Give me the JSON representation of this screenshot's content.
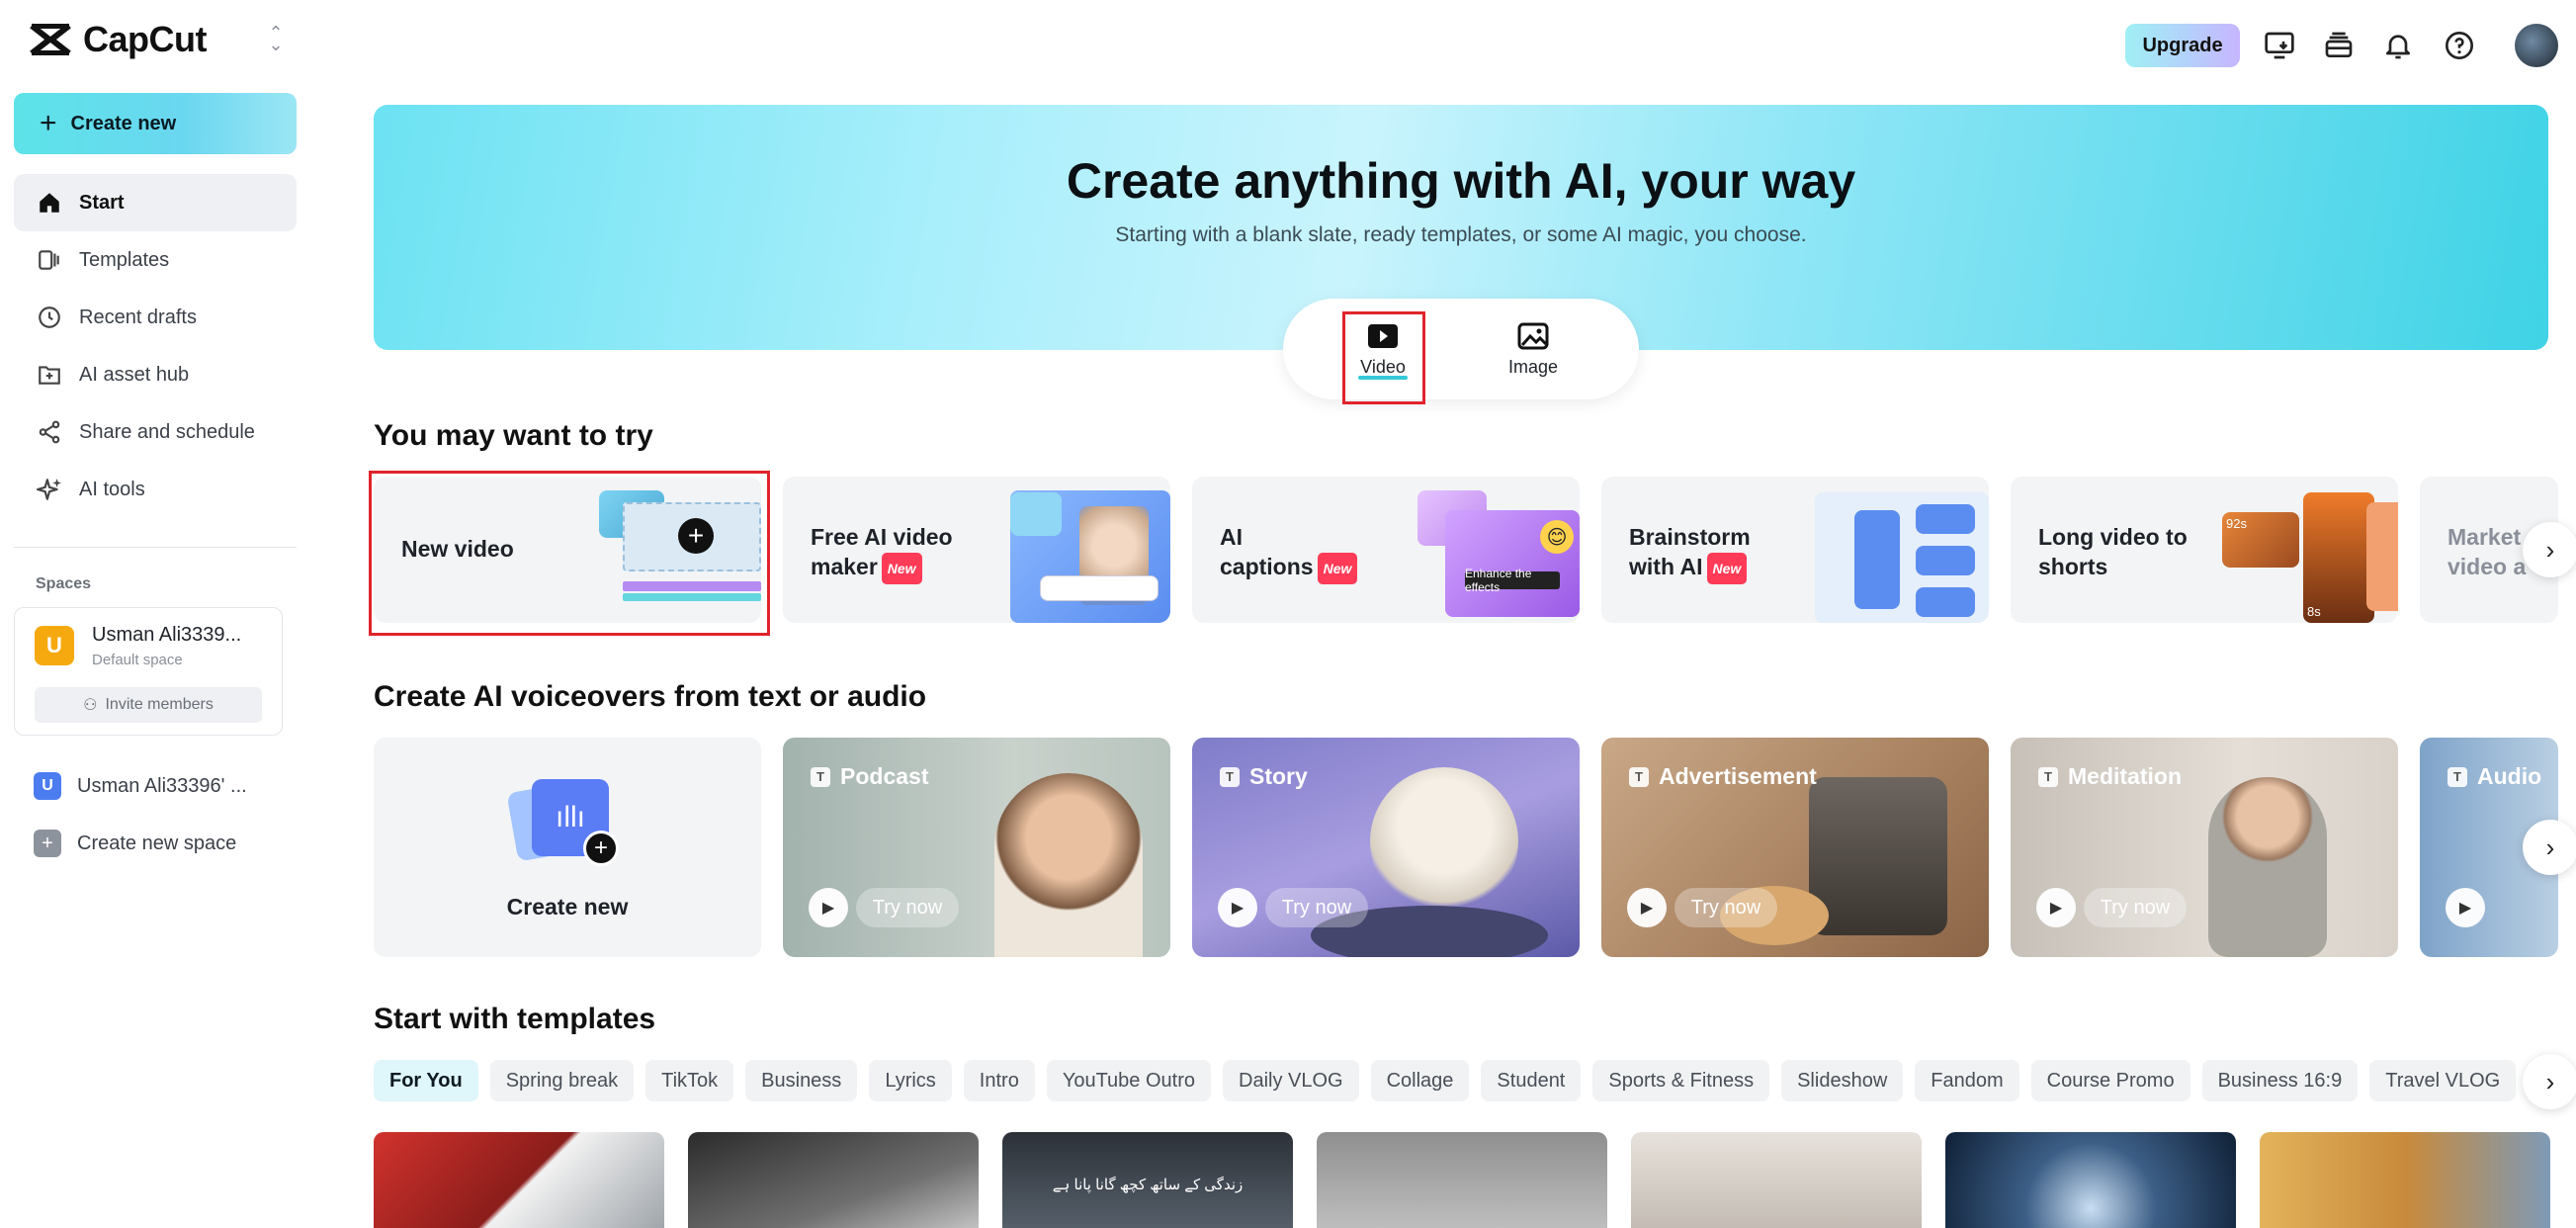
{
  "app": {
    "name": "CapCut"
  },
  "sidebar": {
    "create_label": "Create new",
    "items": [
      {
        "label": "Start",
        "icon": "home-icon"
      },
      {
        "label": "Templates",
        "icon": "templates-icon"
      },
      {
        "label": "Recent drafts",
        "icon": "clock-icon"
      },
      {
        "label": "AI asset hub",
        "icon": "folder-plus-icon"
      },
      {
        "label": "Share and schedule",
        "icon": "share-icon"
      },
      {
        "label": "AI tools",
        "icon": "sparkle-icon"
      }
    ],
    "spaces_title": "Spaces",
    "space": {
      "initial": "U",
      "name": "Usman Ali3339...",
      "sub": "Default space",
      "invite_label": "Invite members"
    },
    "other_space": {
      "initial": "U",
      "name": "Usman Ali33396' ..."
    },
    "create_space_label": "Create new space"
  },
  "topbar": {
    "upgrade_label": "Upgrade"
  },
  "hero": {
    "title": "Create anything with AI, your way",
    "subtitle": "Starting with a blank slate, ready templates, or some AI magic, you choose.",
    "modes": [
      {
        "label": "Video"
      },
      {
        "label": "Image"
      }
    ],
    "selected_mode": "Video"
  },
  "try_section": {
    "title": "You may want to try",
    "cards": [
      {
        "line1": "New video",
        "line2": "",
        "new": false
      },
      {
        "line1": "Free AI video",
        "line2": "maker",
        "new": true
      },
      {
        "line1": "AI",
        "line2": "captions",
        "new": true
      },
      {
        "line1": "Brainstorm",
        "line2": "with AI",
        "new": true
      },
      {
        "line1": "Long video to",
        "line2": "shorts",
        "new": false
      },
      {
        "line1": "Market",
        "line2": "video a",
        "new": false
      }
    ],
    "new_badge": "New",
    "thumb_caption": "Enhance the effects",
    "thumb_times": [
      "92s",
      "8s"
    ]
  },
  "voice_section": {
    "title": "Create AI voiceovers from text or audio",
    "create_label": "Create new",
    "try_label": "Try now",
    "cards": [
      {
        "label": "Podcast"
      },
      {
        "label": "Story"
      },
      {
        "label": "Advertisement"
      },
      {
        "label": "Meditation"
      },
      {
        "label": "Audio"
      }
    ]
  },
  "templates_section": {
    "title": "Start with templates",
    "chips": [
      "For You",
      "Spring break",
      "TikTok",
      "Business",
      "Lyrics",
      "Intro",
      "YouTube Outro",
      "Daily VLOG",
      "Collage",
      "Student",
      "Sports & Fitness",
      "Slideshow",
      "Fandom",
      "Course Promo",
      "Business 16:9",
      "Travel VLOG"
    ],
    "selected_chip": "For You",
    "thumb_text": "زندگی کے ساتھ کچھ گانا پانا ہے"
  },
  "colors": {
    "accent": "#35c9d8",
    "highlight": "#e0242b",
    "badge": "#ff3b57"
  }
}
